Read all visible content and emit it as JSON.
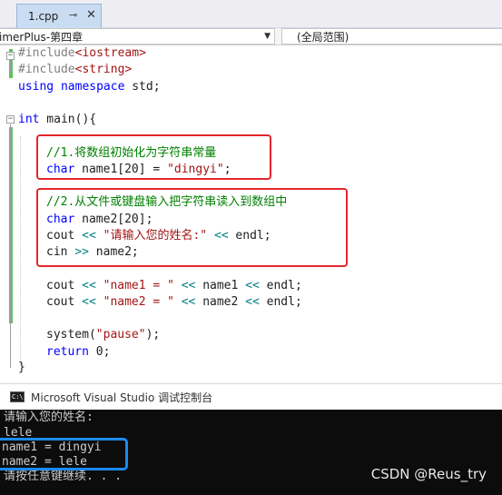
{
  "tab": {
    "title": "1.cpp",
    "pin_glyph": "⊸",
    "close_glyph": "✕"
  },
  "navbar": {
    "project_dropdown": "imerPlus-第四章",
    "scope_dropdown": "(全局范围)",
    "arrow_glyph": "▼"
  },
  "code": {
    "line1": {
      "pre": "#include",
      "inc": "<iostream>"
    },
    "line2": {
      "pre": "#include",
      "inc": "<string>"
    },
    "line3": {
      "kw": "using namespace",
      "rest": " std;"
    },
    "line5": {
      "kw": "int",
      "rest": " main(){"
    },
    "line7": {
      "comment": "//1.将数组初始化为字符串常量"
    },
    "line8": {
      "kw": "char",
      "rest": " name1[20] = ",
      "str": "\"dingyi\"",
      "end": ";"
    },
    "line10": {
      "comment": "//2.从文件或键盘输入把字符串读入到数组中"
    },
    "line11": {
      "kw": "char",
      "rest": " name2[20];"
    },
    "line12": {
      "a": "cout ",
      "op1": "<<",
      "str": " \"请输入您的姓名:\" ",
      "op2": "<<",
      "b": " endl;"
    },
    "line13": {
      "a": "cin ",
      "op1": ">>",
      "b": " name2;"
    },
    "line15": {
      "a": "cout ",
      "op1": "<<",
      "str": " \"name1 = \" ",
      "op2": "<<",
      "b": " name1 ",
      "op3": "<<",
      "c": " endl;"
    },
    "line16": {
      "a": "cout ",
      "op1": "<<",
      "str": " \"name2 = \" ",
      "op2": "<<",
      "b": " name2 ",
      "op3": "<<",
      "c": " endl;"
    },
    "line18": {
      "fn": "system(",
      "str": "\"pause\"",
      "end": ");"
    },
    "line19": {
      "kw": "return",
      "rest": " 0;"
    },
    "line20": {
      "rest": "}"
    },
    "fold_open": "−"
  },
  "console": {
    "icon_text": "C:\\",
    "title": "Microsoft Visual Studio 调试控制台",
    "lines": [
      "请输入您的姓名:",
      "lele",
      "name1 = dingyi",
      "name2 = lele",
      "请按任意键继续. . ."
    ]
  },
  "watermark": "CSDN @Reus_try",
  "colors": {
    "keyword": "#0000ff",
    "string": "#a31515",
    "comment": "#008000",
    "operator": "#008080",
    "highlight_red": "#e5262c",
    "highlight_blue": "#1a8bf0",
    "console_bg": "#0c0c0c"
  }
}
